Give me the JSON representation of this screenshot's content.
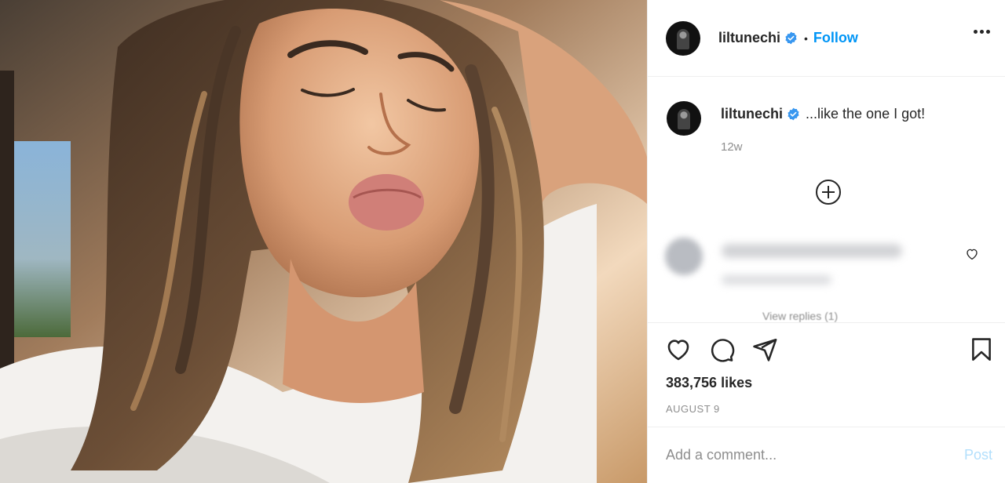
{
  "post": {
    "image_alt": "selfie photo",
    "username": "liltunechi",
    "follow_label": "Follow",
    "dot": "•",
    "caption_text": "...like the one I got!",
    "time_ago": "12w",
    "view_replies": "View replies (1)",
    "likes": "383,756 likes",
    "date": "AUGUST 9"
  },
  "comment_box": {
    "placeholder": "Add a comment...",
    "post_label": "Post"
  },
  "icons": {
    "verified": "verified-badge-icon",
    "more": "more-options-icon",
    "load_more": "plus-circle-icon",
    "like": "heart-icon",
    "comment": "comment-icon",
    "share": "paper-plane-icon",
    "save": "bookmark-icon"
  },
  "colors": {
    "accent": "#0095f6",
    "post_disabled": "#b2dffc",
    "muted": "#8e8e8e",
    "text": "#262626"
  }
}
